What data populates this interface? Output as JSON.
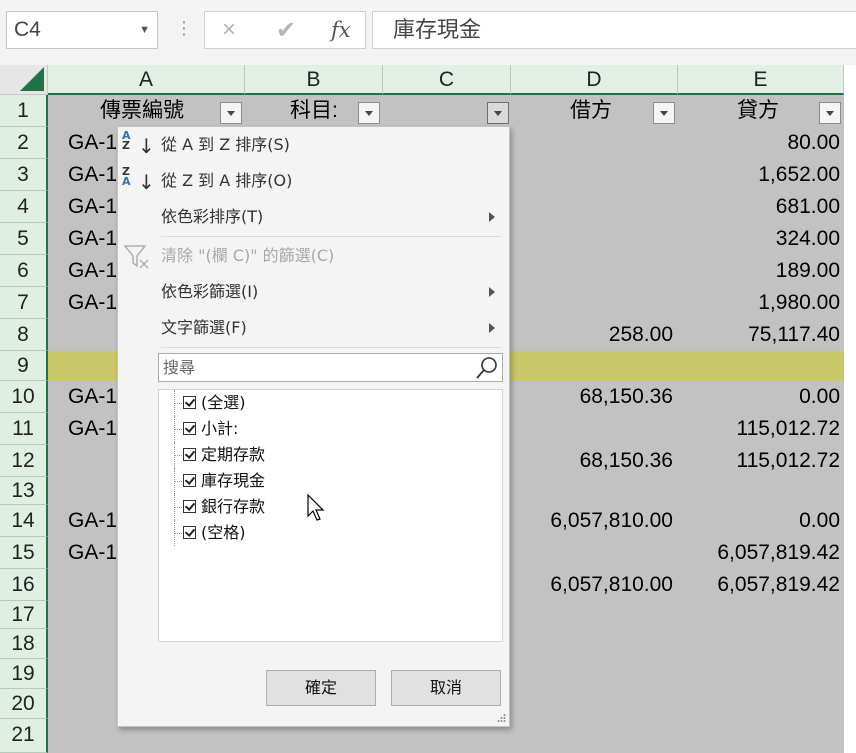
{
  "formula_bar": {
    "name_box": "C4",
    "cancel_icon": "×",
    "enter_icon": "✔",
    "fx_label": "fx",
    "formula": "庫存現金"
  },
  "columns": [
    "A",
    "B",
    "C",
    "D",
    "E"
  ],
  "rows": [
    "1",
    "2",
    "3",
    "4",
    "5",
    "6",
    "7",
    "8",
    "9",
    "10",
    "11",
    "12",
    "13",
    "14",
    "15",
    "16",
    "17",
    "18",
    "19",
    "20",
    "21"
  ],
  "header_row": {
    "a": "傳票編號",
    "b": "科目:",
    "d": "借方",
    "e": "貸方"
  },
  "cells": {
    "a2": "GA-1",
    "a3": "GA-1",
    "a4": "GA-1",
    "a5": "GA-1",
    "a6": "GA-1",
    "a7": "GA-1",
    "a10": "GA-1",
    "a11": "GA-1",
    "a14": "GA-1",
    "a15": "GA-1",
    "e2": "80.00",
    "e3": "1,652.00",
    "e4": "681.00",
    "e5": "324.00",
    "e6": "189.00",
    "e7": "1,980.00",
    "d8": "258.00",
    "e8": "75,117.40",
    "d10": "68,150.36",
    "e10": "0.00",
    "e11": "115,012.72",
    "d12": "68,150.36",
    "e12": "115,012.72",
    "d14": "6,057,810.00",
    "e14": "0.00",
    "e15": "6,057,819.42",
    "d16": "6,057,810.00",
    "e16": "6,057,819.42"
  },
  "filter_menu": {
    "sort_asc": "從 A 到 Z 排序(S)",
    "sort_desc": "從 Z 到 A 排序(O)",
    "sort_by_color": "依色彩排序(T)",
    "clear_filter": "清除 \"(欄 C)\" 的篩選(C)",
    "filter_by_color": "依色彩篩選(I)",
    "text_filters": "文字篩選(F)",
    "search_placeholder": "搜尋",
    "items": [
      "(全選)",
      "小計:",
      "定期存款",
      "庫存現金",
      "銀行存款",
      "(空格)"
    ],
    "ok": "確定",
    "cancel": "取消"
  },
  "colors": {
    "accent_green": "#217346",
    "dim_overlay": "#c2c2c2",
    "highlight_row": "#c9c86a",
    "sort_letter_blue": "#2e75b6"
  }
}
